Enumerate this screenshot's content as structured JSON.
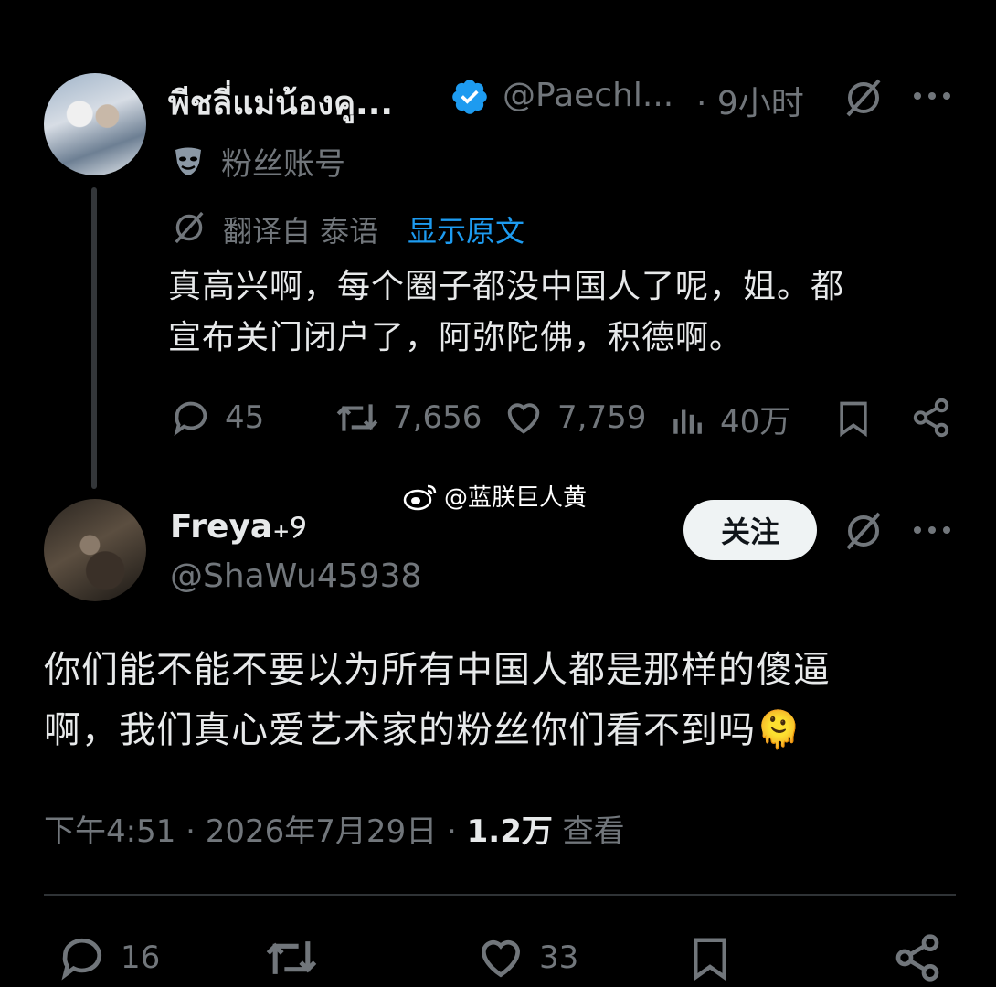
{
  "tweet1": {
    "display_name": "พีชลี่แม่น้องคู...",
    "handle": "@Paechl...",
    "time": "· 9小时",
    "account_label": "粉丝账号",
    "translated_from": "翻译自 泰语",
    "show_original": "显示原文",
    "text_line1": "真高兴啊，每个圈子都没中国人了呢，姐。都",
    "text_line2": "宣布关门闭户了，阿弥陀佛，积德啊。",
    "replies": "45",
    "reposts": "7,656",
    "likes": "7,759",
    "views": "40万"
  },
  "watermark": "@蓝朕巨人黄",
  "tweet2": {
    "display_name": "Freya₊୨",
    "handle": "@ShaWu45938",
    "follow_label": "关注",
    "text_line1": "你们能不能不要以为所有中国人都是那样的傻逼",
    "text_line2": "啊，我们真心爱艺术家的粉丝你们看不到吗",
    "emoji": "🫠",
    "timestamp": "下午4:51 · 2026年7月29日 · ",
    "view_count": "1.2万",
    "view_label": " 查看",
    "replies": "16",
    "reposts": "",
    "likes": "33"
  },
  "colors": {
    "background": "#000000",
    "text": "#e7e9ea",
    "muted": "#71767b",
    "link": "#1d9bf0",
    "verified": "#1d9bf0"
  }
}
